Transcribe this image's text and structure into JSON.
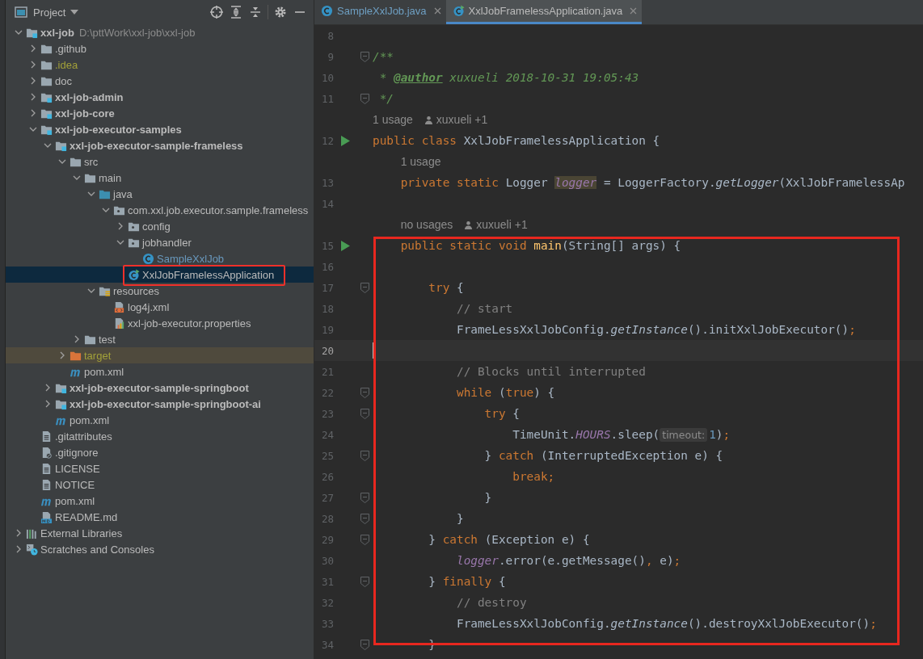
{
  "project_panel": {
    "title": "Project",
    "tree": [
      {
        "label": "xxl-job",
        "path": "D:\\pttWork\\xxl-job\\xxl-job",
        "kind": "module",
        "expanded": true,
        "selected": false,
        "children": [
          {
            "label": ".github",
            "kind": "folder",
            "expanded": false,
            "selected": false
          },
          {
            "label": ".idea",
            "kind": "folder",
            "color": "#a2a039",
            "expanded": false,
            "selected": false
          },
          {
            "label": "doc",
            "kind": "folder",
            "expanded": false,
            "selected": false
          },
          {
            "label": "xxl-job-admin",
            "kind": "module",
            "expanded": false,
            "selected": false
          },
          {
            "label": "xxl-job-core",
            "kind": "module",
            "expanded": false,
            "selected": false
          },
          {
            "label": "xxl-job-executor-samples",
            "kind": "module",
            "expanded": true,
            "selected": false,
            "children": [
              {
                "label": "xxl-job-executor-sample-frameless",
                "kind": "module",
                "expanded": true,
                "selected": false,
                "children": [
                  {
                    "label": "src",
                    "kind": "folder",
                    "expanded": true,
                    "selected": false,
                    "children": [
                      {
                        "label": "main",
                        "kind": "folder",
                        "expanded": true,
                        "selected": false,
                        "children": [
                          {
                            "label": "java",
                            "kind": "source-folder",
                            "expanded": true,
                            "selected": false,
                            "children": [
                              {
                                "label": "com.xxl.job.executor.sample.frameless",
                                "kind": "package",
                                "expanded": true,
                                "selected": false,
                                "children": [
                                  {
                                    "label": "config",
                                    "kind": "package",
                                    "expanded": false,
                                    "selected": false
                                  },
                                  {
                                    "label": "jobhandler",
                                    "kind": "package",
                                    "expanded": true,
                                    "selected": false,
                                    "children": [
                                      {
                                        "label": "SampleXxlJob",
                                        "kind": "class",
                                        "color": "#6897bb",
                                        "selected": false
                                      }
                                    ]
                                  },
                                  {
                                    "label": "XxlJobFramelessApplication",
                                    "kind": "app-class",
                                    "selected": true,
                                    "annotated": true
                                  }
                                ]
                              }
                            ]
                          },
                          {
                            "label": "resources",
                            "kind": "resources-folder",
                            "expanded": true,
                            "selected": false,
                            "children": [
                              {
                                "label": "log4j.xml",
                                "kind": "xml",
                                "selected": false
                              },
                              {
                                "label": "xxl-job-executor.properties",
                                "kind": "properties",
                                "selected": false
                              }
                            ]
                          }
                        ]
                      },
                      {
                        "label": "test",
                        "kind": "folder",
                        "expanded": false,
                        "selected": false
                      }
                    ]
                  },
                  {
                    "label": "target",
                    "kind": "excluded-folder",
                    "color": "#a2a039",
                    "expanded": false,
                    "selected": false
                  },
                  {
                    "label": "pom.xml",
                    "kind": "maven",
                    "selected": false
                  }
                ]
              },
              {
                "label": "xxl-job-executor-sample-springboot",
                "kind": "module",
                "expanded": false,
                "selected": false
              },
              {
                "label": "xxl-job-executor-sample-springboot-ai",
                "kind": "module",
                "expanded": false,
                "selected": false
              },
              {
                "label": "pom.xml",
                "kind": "maven",
                "selected": false
              }
            ]
          },
          {
            "label": ".gitattributes",
            "kind": "text-file",
            "selected": false
          },
          {
            "label": ".gitignore",
            "kind": "gitignore",
            "selected": false
          },
          {
            "label": "LICENSE",
            "kind": "text-file",
            "selected": false
          },
          {
            "label": "NOTICE",
            "kind": "text-file",
            "selected": false
          },
          {
            "label": "pom.xml",
            "kind": "maven",
            "selected": false
          },
          {
            "label": "README.md",
            "kind": "markdown",
            "selected": false
          }
        ]
      },
      {
        "label": "External Libraries",
        "kind": "libraries",
        "expanded": false,
        "selected": false
      },
      {
        "label": "Scratches and Consoles",
        "kind": "scratches",
        "expanded": false,
        "selected": false
      }
    ]
  },
  "editor": {
    "tabs": [
      {
        "label": "SampleXxlJob.java",
        "kind": "class",
        "color": "#6e9fc2",
        "selected": false
      },
      {
        "label": "XxlJobFramelessApplication.java",
        "kind": "app-class",
        "color": "#bbbbbb",
        "selected": true
      }
    ],
    "rows": [
      {
        "kind": "code",
        "number": "8",
        "tokens": []
      },
      {
        "kind": "code",
        "number": "9",
        "fold": true,
        "tokens": [
          {
            "t": "/**",
            "kind": "doc"
          }
        ]
      },
      {
        "kind": "code",
        "number": "10",
        "tokens": [
          {
            "t": " * ",
            "kind": "doc"
          },
          {
            "t": "@author",
            "kind": "doctag"
          },
          {
            "t": " xuxueli 2018-10-31 19:05:43",
            "kind": "doc"
          }
        ]
      },
      {
        "kind": "code",
        "number": "11",
        "fold": true,
        "tokens": [
          {
            "t": " */",
            "kind": "doc"
          }
        ]
      },
      {
        "kind": "hint",
        "usages": "1 usage",
        "author": "xuxueli +1"
      },
      {
        "kind": "code",
        "number": "12",
        "run": true,
        "tokens": [
          {
            "t": "public class ",
            "kind": "kw"
          },
          {
            "t": "XxlJobFramelessApplication {",
            "kind": "plain"
          }
        ]
      },
      {
        "kind": "hint",
        "usages": "1 usage"
      },
      {
        "kind": "code",
        "number": "13",
        "tokens": [
          {
            "t": "    private static ",
            "kind": "kw"
          },
          {
            "t": "Logger ",
            "kind": "plain"
          },
          {
            "t": "logger",
            "kind": "field-hl"
          },
          {
            "t": " = LoggerFactory.",
            "kind": "plain"
          },
          {
            "t": "getLogger",
            "kind": "italic"
          },
          {
            "t": "(XxlJobFramelessAp",
            "kind": "plain"
          }
        ]
      },
      {
        "kind": "code",
        "number": "14",
        "tokens": []
      },
      {
        "kind": "hint",
        "usages": "no usages",
        "author": "xuxueli +1"
      },
      {
        "kind": "box",
        "rows": [
          {
            "kind": "code",
            "number": "15",
            "run": true,
            "tokens": [
              {
                "t": "    public static void ",
                "kind": "kw"
              },
              {
                "t": "main",
                "kind": "decl"
              },
              {
                "t": "(String[] args) {",
                "kind": "plain"
              }
            ]
          },
          {
            "kind": "code",
            "number": "16",
            "tokens": []
          },
          {
            "kind": "code",
            "number": "17",
            "fold": true,
            "tokens": [
              {
                "t": "        try ",
                "kind": "kw"
              },
              {
                "t": "{",
                "kind": "plain"
              }
            ]
          },
          {
            "kind": "code",
            "number": "18",
            "tokens": [
              {
                "t": "            // start",
                "kind": "comment"
              }
            ]
          },
          {
            "kind": "code",
            "number": "19",
            "tokens": [
              {
                "t": "            FrameLessXxlJobConfig.",
                "kind": "plain"
              },
              {
                "t": "getInstance",
                "kind": "italic"
              },
              {
                "t": "().initXxlJobExecutor()",
                "kind": "plain"
              },
              {
                "t": ";",
                "kind": "kw"
              }
            ]
          },
          {
            "kind": "code",
            "number": "20",
            "current": true,
            "tokens": []
          },
          {
            "kind": "code",
            "number": "21",
            "tokens": [
              {
                "t": "            // Blocks until interrupted",
                "kind": "comment"
              }
            ]
          },
          {
            "kind": "code",
            "number": "22",
            "fold": true,
            "tokens": [
              {
                "t": "            while ",
                "kind": "kw"
              },
              {
                "t": "(",
                "kind": "plain"
              },
              {
                "t": "true",
                "kind": "kw"
              },
              {
                "t": ") {",
                "kind": "plain"
              }
            ]
          },
          {
            "kind": "code",
            "number": "23",
            "fold": true,
            "tokens": [
              {
                "t": "                try ",
                "kind": "kw"
              },
              {
                "t": "{",
                "kind": "plain"
              }
            ]
          },
          {
            "kind": "code",
            "number": "24",
            "tokens": [
              {
                "t": "                    TimeUnit.",
                "kind": "plain"
              },
              {
                "t": "HOURS",
                "kind": "field"
              },
              {
                "t": ".sleep(",
                "kind": "plain"
              },
              {
                "t": "timeout:",
                "kind": "hint"
              },
              {
                "t": "1",
                "kind": "num"
              },
              {
                "t": ")",
                "kind": "plain"
              },
              {
                "t": ";",
                "kind": "kw"
              }
            ]
          },
          {
            "kind": "code",
            "number": "25",
            "fold": true,
            "tokens": [
              {
                "t": "                } ",
                "kind": "plain"
              },
              {
                "t": "catch ",
                "kind": "kw"
              },
              {
                "t": "(InterruptedException e) {",
                "kind": "plain"
              }
            ]
          },
          {
            "kind": "code",
            "number": "26",
            "tokens": [
              {
                "t": "                    break;",
                "kind": "kw"
              }
            ]
          },
          {
            "kind": "code",
            "number": "27",
            "fold": true,
            "tokens": [
              {
                "t": "                }",
                "kind": "plain"
              }
            ]
          },
          {
            "kind": "code",
            "number": "28",
            "fold": true,
            "tokens": [
              {
                "t": "            }",
                "kind": "plain"
              }
            ]
          },
          {
            "kind": "code",
            "number": "29",
            "fold": true,
            "tokens": [
              {
                "t": "        } ",
                "kind": "plain"
              },
              {
                "t": "catch ",
                "kind": "kw"
              },
              {
                "t": "(Exception e) {",
                "kind": "plain"
              }
            ]
          },
          {
            "kind": "code",
            "number": "30",
            "tokens": [
              {
                "t": "            logger",
                "kind": "field"
              },
              {
                "t": ".error(e.getMessage()",
                "kind": "plain"
              },
              {
                "t": ", ",
                "kind": "kw"
              },
              {
                "t": "e)",
                "kind": "plain"
              },
              {
                "t": ";",
                "kind": "kw"
              }
            ]
          },
          {
            "kind": "code",
            "number": "31",
            "fold": true,
            "tokens": [
              {
                "t": "        } ",
                "kind": "plain"
              },
              {
                "t": "finally ",
                "kind": "kw"
              },
              {
                "t": "{",
                "kind": "plain"
              }
            ]
          },
          {
            "kind": "code",
            "number": "32",
            "tokens": [
              {
                "t": "            // destroy",
                "kind": "comment"
              }
            ]
          },
          {
            "kind": "code",
            "number": "33",
            "tokens": [
              {
                "t": "            FrameLessXxlJobConfig.",
                "kind": "plain"
              },
              {
                "t": "getInstance",
                "kind": "italic"
              },
              {
                "t": "().destroyXxlJobExecutor()",
                "kind": "plain"
              },
              {
                "t": ";",
                "kind": "kw"
              }
            ]
          },
          {
            "kind": "code",
            "number": "34",
            "fold": true,
            "tokens": [
              {
                "t": "        }",
                "kind": "plain"
              }
            ]
          }
        ]
      }
    ]
  }
}
